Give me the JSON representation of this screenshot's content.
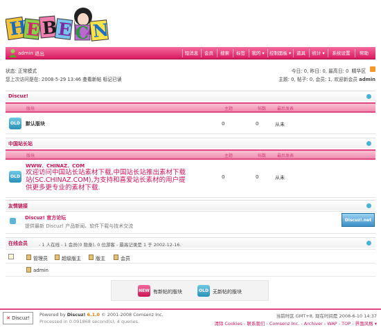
{
  "header": {
    "logo_text": "HEBECN",
    "user": "admin",
    "logout": "退出"
  },
  "nav": {
    "items": [
      "短消息",
      "会员",
      "搜索",
      "标签",
      "我的",
      "控制面板",
      "道具",
      "统计",
      "系统设置",
      "帮助"
    ]
  },
  "status": {
    "mode": "状态: 正常模式",
    "last_visit_prefix": "您上次访问是在:",
    "last_visit_time": "2008-5-29 13:46",
    "view_new": "查看新帖",
    "mark_read": "标记已读",
    "today_stats": "今日: 0, 昨日: 0, 最高日: 0",
    "elite": "精华区",
    "thread_stats": "主题: 0, 帖子: 0, 会员: 1, 欢迎新会员",
    "new_member": "admin"
  },
  "section_discuz": {
    "title": "Discuz!",
    "columns": [
      "版块",
      "主题",
      "帖数",
      "最后发表"
    ],
    "forum": {
      "icon_text": "OLD",
      "name": "默认版块",
      "threads": "0",
      "posts": "0",
      "last": "从未"
    }
  },
  "section_chinaz": {
    "title": "中国站长站",
    "columns": [
      "版块",
      "主题",
      "帖数",
      "最后发表"
    ],
    "forum": {
      "icon_text": "OLD",
      "url_line": "WWW．CHINAZ．COM",
      "desc_line1": "欢迎访问中国站长站素材下载,中国站长站推出素材下载",
      "desc_line2": "站(SC.CHINAZ.COM),为支持和喜爱站长素材的用户提",
      "desc_line3": "供更多更专业的素材下载.",
      "threads": "0",
      "posts": "0",
      "last": "从未"
    }
  },
  "section_links": {
    "title": "友情链接",
    "link_name": "Discuz! 官方论坛",
    "link_desc": "提供最新 Discuz! 产品新闻、软件下载与技术交流",
    "banner_text": "Discuz!.net"
  },
  "section_online": {
    "title": "在线会员",
    "summary": "- 1 人在线 - 1 会员(0 隐身), 0 位游客 - 最高记录是 1 于 2002-12-16.",
    "legend": [
      "管理员",
      "超级版主",
      "版主",
      "会员"
    ],
    "online_user": "admin"
  },
  "legend_box": {
    "new_icon": "NEW",
    "new_label": "有新帖的版块",
    "old_icon": "OLD",
    "old_label": "无新帖的版块"
  },
  "footer": {
    "box_label": "Discuz!",
    "powered_prefix": "Powered by",
    "powered_name": "Discuz!",
    "version": "6.1.0",
    "copyright": "© 2001-2008 Comsenz Inc.",
    "processed": "Processed in 0.091868 second(s), 4 queries.",
    "time_info": "当前时区 GMT+8, 现在时间是 2008-6-10 14:37",
    "links": "清除 Cookies - 联系我们 - Comsenz Inc. - Archiver - WAP - TOP - 界面风格"
  },
  "colors": {
    "accent": "#e04781",
    "link": "#c8135b",
    "toggle": "#4ab3d6"
  }
}
